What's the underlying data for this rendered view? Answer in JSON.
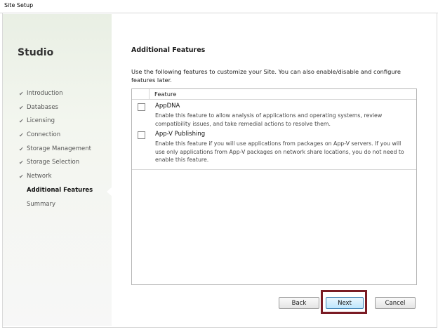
{
  "window": {
    "title": "Site Setup"
  },
  "sidebar": {
    "brand": "Studio",
    "steps": [
      {
        "label": "Introduction",
        "status": "done"
      },
      {
        "label": "Databases",
        "status": "done"
      },
      {
        "label": "Licensing",
        "status": "done"
      },
      {
        "label": "Connection",
        "status": "done"
      },
      {
        "label": "Storage Management",
        "status": "done"
      },
      {
        "label": "Storage Selection",
        "status": "done"
      },
      {
        "label": "Network",
        "status": "done"
      },
      {
        "label": "Additional Features",
        "status": "current"
      },
      {
        "label": "Summary",
        "status": "pending"
      }
    ],
    "check_glyph": "✔"
  },
  "main": {
    "title": "Additional Features",
    "intro": "Use the following features to customize your Site.  You can also enable/disable and configure features later.",
    "table": {
      "column_header": "Feature",
      "features": [
        {
          "name": "AppDNA",
          "description": "Enable this feature to allow analysis of applications and operating systems, review compatibility issues, and take remedial actions to resolve them.",
          "checked": false
        },
        {
          "name": "App-V Publishing",
          "description": "Enable this feature if you will use applications from packages on App-V servers. If you will use only applications from App-V packages on network share locations, you do not need to enable this feature.",
          "checked": false
        }
      ]
    }
  },
  "buttons": {
    "back": "Back",
    "next": "Next",
    "cancel": "Cancel"
  },
  "colors": {
    "highlight_border": "#7a1b24",
    "next_button_border": "#3c7fb1",
    "sidebar_top": "#e9efe4"
  }
}
